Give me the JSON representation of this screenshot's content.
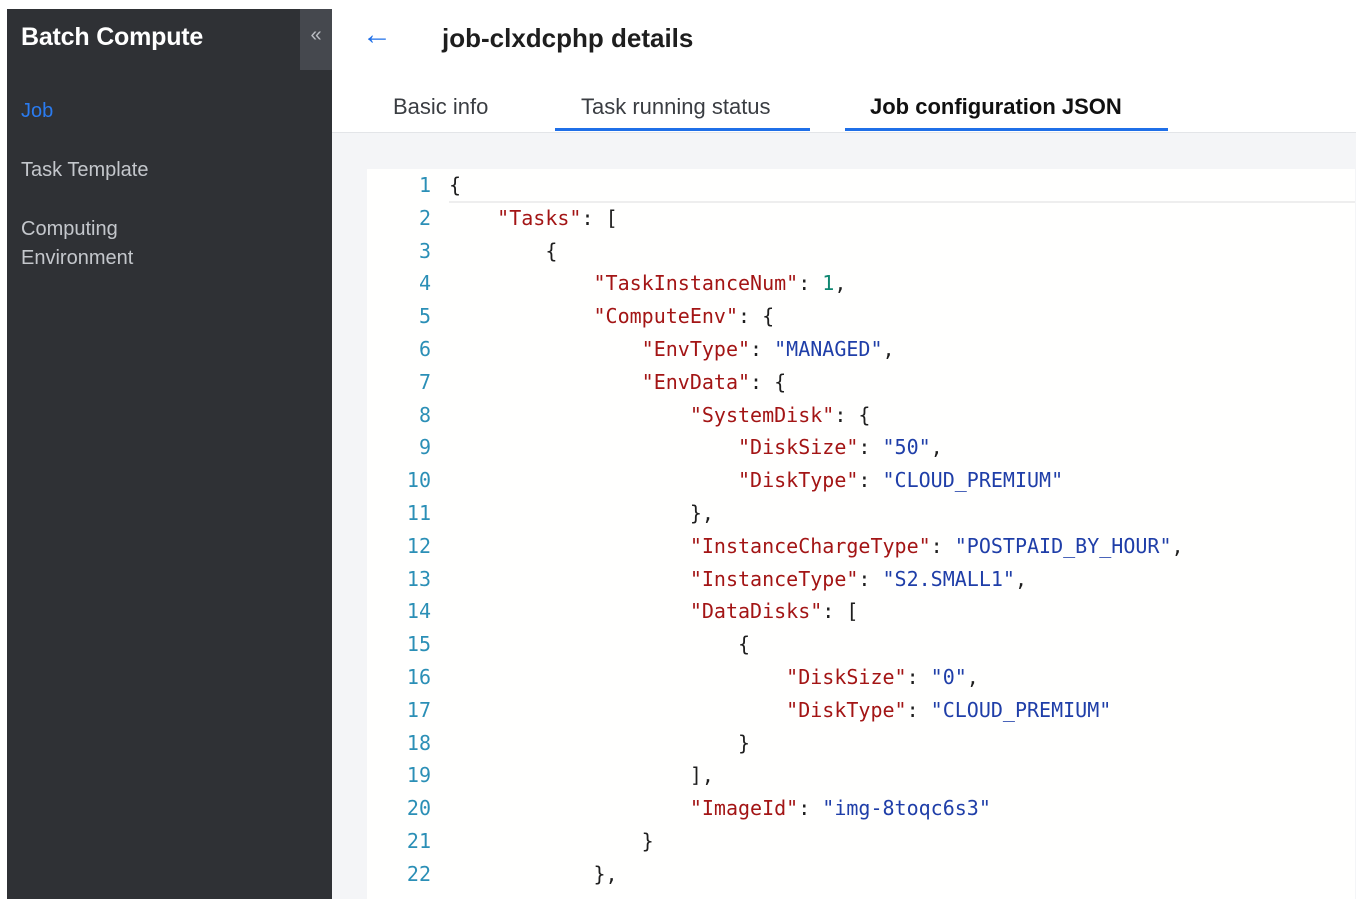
{
  "sidebar": {
    "title": "Batch Compute",
    "collapse_icon": "«",
    "items": [
      {
        "label": "Job",
        "active": true
      },
      {
        "label": "Task Template",
        "active": false
      },
      {
        "label": "Computing",
        "label2": "Environment",
        "active": false
      }
    ]
  },
  "header": {
    "back_icon": "←",
    "title": "job-clxdcphp details",
    "tabs": [
      {
        "label": "Basic info"
      },
      {
        "label": "Task running status"
      },
      {
        "label": "Job configuration JSON",
        "active": true
      }
    ]
  },
  "editor": {
    "colors": {
      "key": "#a31515",
      "string": "#1f3ea8",
      "number": "#0e8670",
      "line_number": "#2b8fb6"
    },
    "lines": [
      {
        "n": "1",
        "code": "{"
      },
      {
        "n": "2",
        "code": "    \"Tasks\": ["
      },
      {
        "n": "3",
        "code": "        {"
      },
      {
        "n": "4",
        "code": "            \"TaskInstanceNum\": 1,"
      },
      {
        "n": "5",
        "code": "            \"ComputeEnv\": {"
      },
      {
        "n": "6",
        "code": "                \"EnvType\": \"MANAGED\","
      },
      {
        "n": "7",
        "code": "                \"EnvData\": {"
      },
      {
        "n": "8",
        "code": "                    \"SystemDisk\": {"
      },
      {
        "n": "9",
        "code": "                        \"DiskSize\": \"50\","
      },
      {
        "n": "10",
        "code": "                        \"DiskType\": \"CLOUD_PREMIUM\""
      },
      {
        "n": "11",
        "code": "                    },"
      },
      {
        "n": "12",
        "code": "                    \"InstanceChargeType\": \"POSTPAID_BY_HOUR\","
      },
      {
        "n": "13",
        "code": "                    \"InstanceType\": \"S2.SMALL1\","
      },
      {
        "n": "14",
        "code": "                    \"DataDisks\": ["
      },
      {
        "n": "15",
        "code": "                        {"
      },
      {
        "n": "16",
        "code": "                            \"DiskSize\": \"0\","
      },
      {
        "n": "17",
        "code": "                            \"DiskType\": \"CLOUD_PREMIUM\""
      },
      {
        "n": "18",
        "code": "                        }"
      },
      {
        "n": "19",
        "code": "                    ],"
      },
      {
        "n": "20",
        "code": "                    \"ImageId\": \"img-8toqc6s3\""
      },
      {
        "n": "21",
        "code": "                }"
      },
      {
        "n": "22",
        "code": "            },"
      }
    ]
  }
}
